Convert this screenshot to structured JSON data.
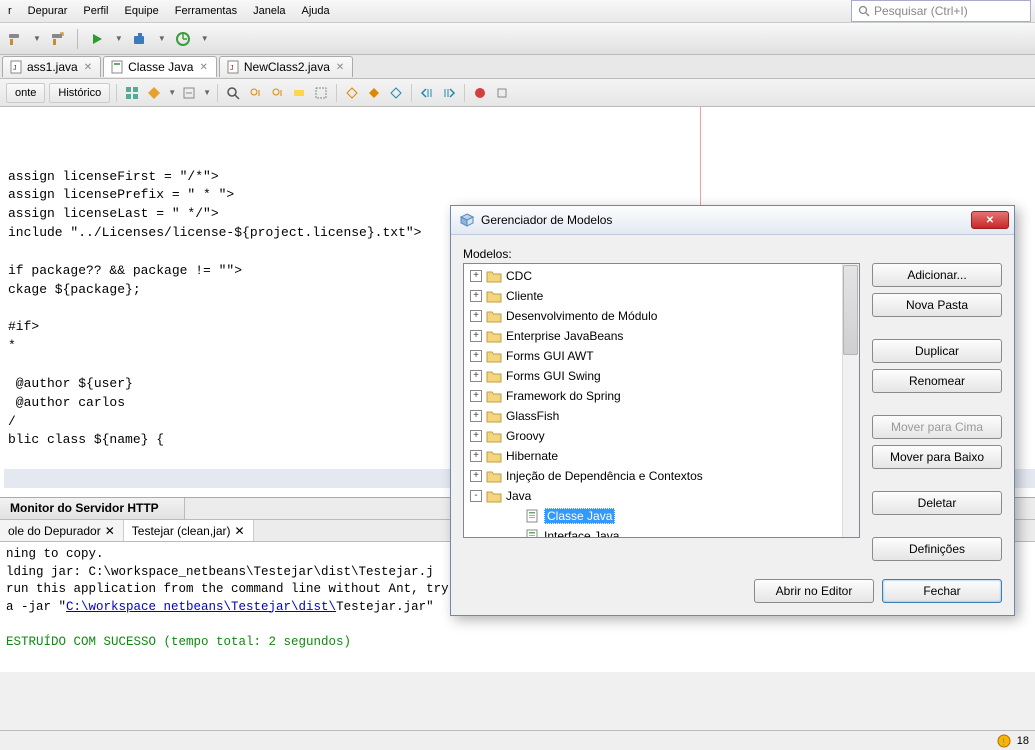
{
  "menu": {
    "items": [
      "r",
      "Depurar",
      "Perfil",
      "Equipe",
      "Ferramentas",
      "Janela",
      "Ajuda"
    ]
  },
  "search": {
    "placeholder": "Pesquisar (Ctrl+I)"
  },
  "tabs": [
    {
      "label": "ass1.java",
      "active": false
    },
    {
      "label": "Classe Java",
      "active": true
    },
    {
      "label": "NewClass2.java",
      "active": false
    }
  ],
  "subToolbar": {
    "fonte": "onte",
    "historico": "Histórico"
  },
  "code_lines": [
    "assign licenseFirst = \"/*\">",
    "assign licensePrefix = \" * \">",
    "assign licenseLast = \" */\">",
    "include \"../Licenses/license-${project.license}.txt\">",
    "",
    "if package?? && package != \"\">",
    "ckage ${package};",
    "",
    "#if>",
    "*",
    "",
    " @author ${user}",
    " @author carlos",
    "/",
    "blic class ${name} {",
    "",
    ""
  ],
  "caret_line_index": 16,
  "bottomTabs": {
    "monitor": "Monitor do Servidor HTTP"
  },
  "bottomSubTabs": {
    "depurador": "ole do Depurador",
    "testejar": "Testejar (clean,jar)"
  },
  "output": {
    "l1": "ning to copy.",
    "l2a": "lding jar: C:\\workspace_netbeans\\Testejar\\dist\\Testejar.j",
    "l3": "run this application from the command line without Ant, try:",
    "l4a": "a -jar \"",
    "l4b": "C:\\workspace_netbeans\\Testejar\\dist\\",
    "l4c": "Testejar.jar\"",
    "l5": "ESTRUÍDO COM SUCESSO (tempo total: 2 segundos)"
  },
  "status": {
    "col": "18"
  },
  "dialog": {
    "title": "Gerenciador de Modelos",
    "modelosLabel": "Modelos:",
    "tree": [
      {
        "label": "CDC",
        "exp": "+",
        "ic": "folder"
      },
      {
        "label": "Cliente",
        "exp": "+",
        "ic": "folder"
      },
      {
        "label": "Desenvolvimento de Módulo",
        "exp": "+",
        "ic": "folder"
      },
      {
        "label": "Enterprise JavaBeans",
        "exp": "+",
        "ic": "folder"
      },
      {
        "label": "Forms GUI AWT",
        "exp": "+",
        "ic": "folder"
      },
      {
        "label": "Forms GUI Swing",
        "exp": "+",
        "ic": "folder"
      },
      {
        "label": "Framework do Spring",
        "exp": "+",
        "ic": "folder"
      },
      {
        "label": "GlassFish",
        "exp": "+",
        "ic": "folder"
      },
      {
        "label": "Groovy",
        "exp": "+",
        "ic": "folder"
      },
      {
        "label": "Hibernate",
        "exp": "+",
        "ic": "folder"
      },
      {
        "label": "Injeção de Dependência e Contextos",
        "exp": "+",
        "ic": "folder"
      },
      {
        "label": "Java",
        "exp": "-",
        "ic": "folder",
        "children": [
          {
            "label": "Classe Java",
            "ic": "file",
            "selected": true
          },
          {
            "label": "Interface Java",
            "ic": "file"
          }
        ]
      }
    ],
    "buttons": {
      "adicionar": "Adicionar...",
      "novaPasta": "Nova Pasta",
      "duplicar": "Duplicar",
      "renomear": "Renomear",
      "moverCima": "Mover para Cima",
      "moverBaixo": "Mover para Baixo",
      "deletar": "Deletar",
      "definicoes": "Definições",
      "abrirEditor": "Abrir no Editor",
      "fechar": "Fechar"
    }
  }
}
